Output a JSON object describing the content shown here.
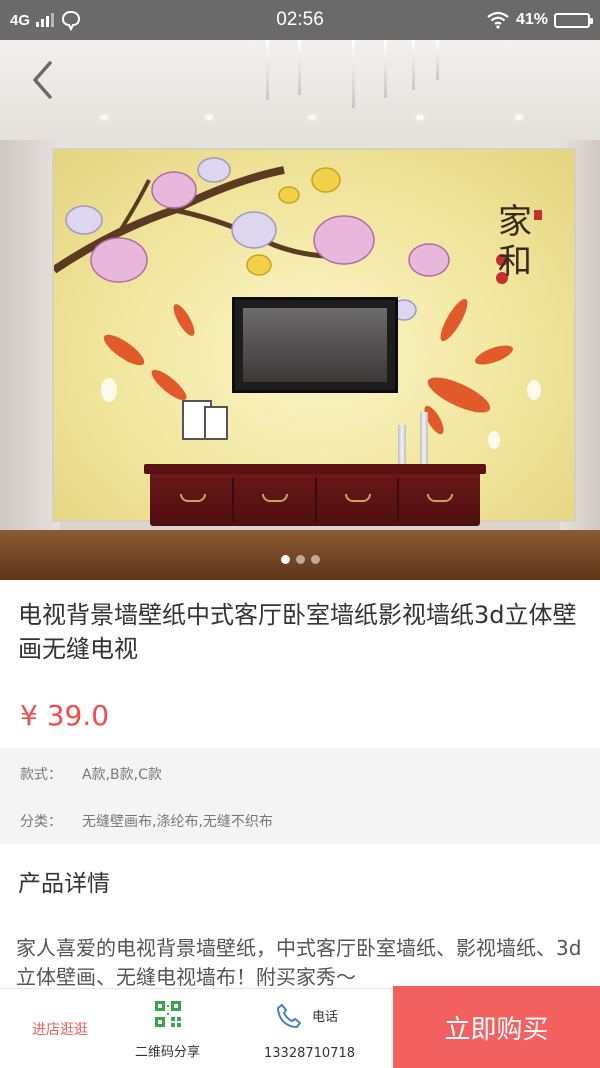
{
  "status_bar": {
    "network": "4G",
    "time": "02:56",
    "battery": "41%"
  },
  "gallery": {
    "image_description_icon": "wallpaper-photo",
    "calligraphy": "家和",
    "slide_count": 3,
    "active_slide": 1
  },
  "product": {
    "title": "电视背景墙壁纸中式客厅卧室墙纸影视墙纸3d立体壁画无缝电视",
    "price": "¥ 39.0",
    "specs": [
      {
        "label": "款式：",
        "value": "A款,B款,C款"
      },
      {
        "label": "分类：",
        "value": "无缝壁画布,涤纶布,无缝不织布"
      }
    ],
    "detail_heading": "产品详情",
    "description": "家人喜爱的￼电视背景墙壁纸，中式客厅卧室墙纸、影视墙纸、3d立体壁画、无缝电视墙布！附买家秀～"
  },
  "bottom_bar": {
    "shop_label": "进店逛逛",
    "qr_label": "二维码分享",
    "phone_label": "电话",
    "phone_number": "13328710718",
    "buy_label": "立即购买"
  },
  "colors": {
    "accent": "#f26060",
    "price": "#f24b4b",
    "statusbar": "#6a6a6a",
    "qr_green": "#3aa54a",
    "phone_blue": "#4a7fc1"
  }
}
